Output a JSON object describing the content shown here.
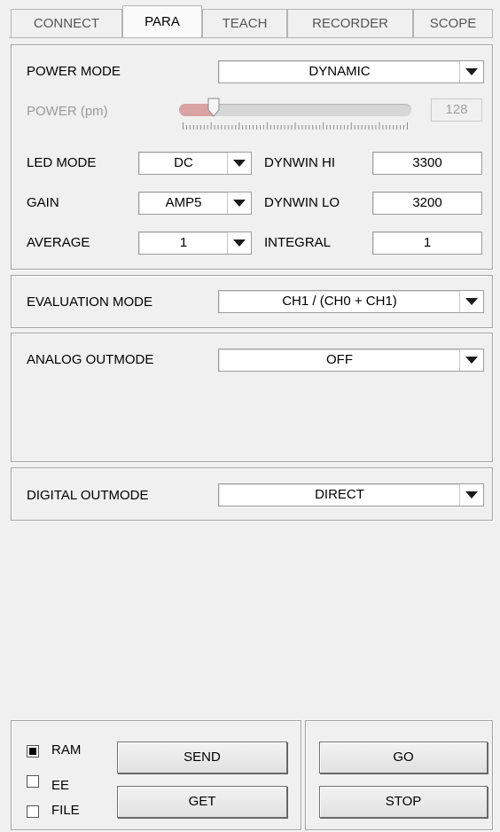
{
  "tabs": [
    {
      "label": "CONNECT"
    },
    {
      "label": "PARA"
    },
    {
      "label": "TEACH"
    },
    {
      "label": "RECORDER"
    },
    {
      "label": "SCOPE"
    }
  ],
  "active_tab": "PARA",
  "para": {
    "power_mode": {
      "label": "POWER MODE",
      "value": "DYNAMIC"
    },
    "power": {
      "label": "POWER (pm)",
      "value": "128",
      "level_fraction": 0.128
    },
    "led_mode": {
      "label": "LED MODE",
      "value": "DC"
    },
    "gain": {
      "label": "GAIN",
      "value": "AMP5"
    },
    "average": {
      "label": "AVERAGE",
      "value": "1"
    },
    "dynwin_hi": {
      "label": "DYNWIN HI",
      "value": "3300"
    },
    "dynwin_lo": {
      "label": "DYNWIN LO",
      "value": "3200"
    },
    "integral": {
      "label": "INTEGRAL",
      "value": "1"
    }
  },
  "evaluation": {
    "label": "EVALUATION MODE",
    "value": "CH1 / (CH0 + CH1)"
  },
  "analog": {
    "label": "ANALOG OUTMODE",
    "value": "OFF"
  },
  "digital": {
    "label": "DIGITAL OUTMODE",
    "value": "DIRECT"
  },
  "footer": {
    "ram": {
      "label": "RAM",
      "checked": true
    },
    "ee": {
      "label": "EE",
      "checked": false
    },
    "file": {
      "label": "FILE",
      "checked": false
    },
    "send_label": "SEND",
    "get_label": "GET",
    "go_label": "GO",
    "stop_label": "STOP"
  }
}
